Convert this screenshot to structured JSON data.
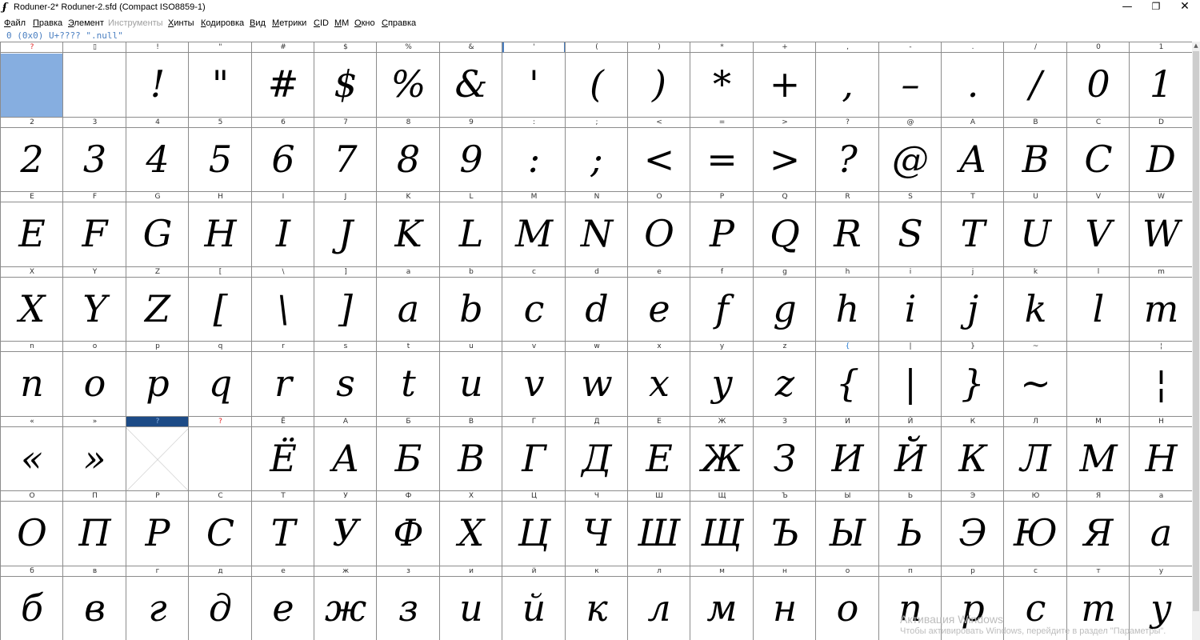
{
  "window": {
    "title": "Roduner-2*  Roduner-2.sfd (Compact ISO8859-1)",
    "app_icon_glyph": "ʄ",
    "minimize_glyph": "—",
    "maximize_glyph": "❐",
    "close_glyph": "✕"
  },
  "menu": [
    {
      "label": "Файл",
      "disabled": false
    },
    {
      "label": "Правка",
      "disabled": false
    },
    {
      "label": "Элемент",
      "disabled": false
    },
    {
      "label": "Инструменты",
      "disabled": true
    },
    {
      "label": "Хинты",
      "disabled": false
    },
    {
      "label": "Кодировка",
      "disabled": false
    },
    {
      "label": "Вид",
      "disabled": false
    },
    {
      "label": "Метрики",
      "disabled": false
    },
    {
      "label": "CID",
      "disabled": false
    },
    {
      "label": "MM",
      "disabled": false
    },
    {
      "label": "Окно",
      "disabled": false
    },
    {
      "label": "Справка",
      "disabled": false
    }
  ],
  "info_line": "0 (0x0) U+???? \".null\"",
  "colors": {
    "selected_glyph_bg": "#86aee0",
    "selected_label_bg": "#1d4b86",
    "missing_label": "#e02020",
    "info_text": "#4a7fc1"
  },
  "rows": [
    [
      {
        "label": "?",
        "glyph": "",
        "label_color": "red",
        "selected": true
      },
      {
        "label": "▯",
        "glyph": ""
      },
      {
        "label": "!",
        "glyph": "!"
      },
      {
        "label": "\"",
        "glyph": "\""
      },
      {
        "label": "#",
        "glyph": "#"
      },
      {
        "label": "$",
        "glyph": "$"
      },
      {
        "label": "%",
        "glyph": "%"
      },
      {
        "label": "&",
        "glyph": "&"
      },
      {
        "label": "'",
        "glyph": "'",
        "tick": true
      },
      {
        "label": "(",
        "glyph": "("
      },
      {
        "label": ")",
        "glyph": ")"
      },
      {
        "label": "*",
        "glyph": "*"
      },
      {
        "label": "+",
        "glyph": "+"
      },
      {
        "label": ",",
        "glyph": ","
      },
      {
        "label": "-",
        "glyph": "–"
      },
      {
        "label": ".",
        "glyph": "."
      },
      {
        "label": "/",
        "glyph": "/"
      },
      {
        "label": "0",
        "glyph": "0"
      },
      {
        "label": "1",
        "glyph": "1"
      }
    ],
    [
      {
        "label": "2",
        "glyph": "2"
      },
      {
        "label": "3",
        "glyph": "3"
      },
      {
        "label": "4",
        "glyph": "4"
      },
      {
        "label": "5",
        "glyph": "5"
      },
      {
        "label": "6",
        "glyph": "6"
      },
      {
        "label": "7",
        "glyph": "7"
      },
      {
        "label": "8",
        "glyph": "8"
      },
      {
        "label": "9",
        "glyph": "9"
      },
      {
        "label": ":",
        "glyph": ":"
      },
      {
        "label": ";",
        "glyph": ";"
      },
      {
        "label": "<",
        "glyph": "<"
      },
      {
        "label": "=",
        "glyph": "="
      },
      {
        "label": ">",
        "glyph": ">"
      },
      {
        "label": "?",
        "glyph": "?"
      },
      {
        "label": "@",
        "glyph": "@"
      },
      {
        "label": "A",
        "glyph": "A"
      },
      {
        "label": "B",
        "glyph": "B"
      },
      {
        "label": "C",
        "glyph": "C"
      },
      {
        "label": "D",
        "glyph": "D"
      }
    ],
    [
      {
        "label": "E",
        "glyph": "E"
      },
      {
        "label": "F",
        "glyph": "F"
      },
      {
        "label": "G",
        "glyph": "G"
      },
      {
        "label": "H",
        "glyph": "H"
      },
      {
        "label": "I",
        "glyph": "I"
      },
      {
        "label": "J",
        "glyph": "J"
      },
      {
        "label": "K",
        "glyph": "K"
      },
      {
        "label": "L",
        "glyph": "L"
      },
      {
        "label": "M",
        "glyph": "M"
      },
      {
        "label": "N",
        "glyph": "N"
      },
      {
        "label": "O",
        "glyph": "O"
      },
      {
        "label": "P",
        "glyph": "P"
      },
      {
        "label": "Q",
        "glyph": "Q"
      },
      {
        "label": "R",
        "glyph": "R"
      },
      {
        "label": "S",
        "glyph": "S"
      },
      {
        "label": "T",
        "glyph": "T"
      },
      {
        "label": "U",
        "glyph": "U"
      },
      {
        "label": "V",
        "glyph": "V"
      },
      {
        "label": "W",
        "glyph": "W"
      }
    ],
    [
      {
        "label": "X",
        "glyph": "X"
      },
      {
        "label": "Y",
        "glyph": "Y"
      },
      {
        "label": "Z",
        "glyph": "Z"
      },
      {
        "label": "[",
        "glyph": "["
      },
      {
        "label": "\\",
        "glyph": "\\"
      },
      {
        "label": "]",
        "glyph": "]"
      },
      {
        "label": "a",
        "glyph": "a"
      },
      {
        "label": "b",
        "glyph": "b"
      },
      {
        "label": "c",
        "glyph": "c"
      },
      {
        "label": "d",
        "glyph": "d"
      },
      {
        "label": "e",
        "glyph": "e"
      },
      {
        "label": "f",
        "glyph": "f"
      },
      {
        "label": "g",
        "glyph": "g"
      },
      {
        "label": "h",
        "glyph": "h"
      },
      {
        "label": "i",
        "glyph": "i"
      },
      {
        "label": "j",
        "glyph": "j"
      },
      {
        "label": "k",
        "glyph": "k"
      },
      {
        "label": "l",
        "glyph": "l"
      },
      {
        "label": "m",
        "glyph": "m"
      }
    ],
    [
      {
        "label": "n",
        "glyph": "n"
      },
      {
        "label": "o",
        "glyph": "o"
      },
      {
        "label": "p",
        "glyph": "p"
      },
      {
        "label": "q",
        "glyph": "q"
      },
      {
        "label": "r",
        "glyph": "r"
      },
      {
        "label": "s",
        "glyph": "s"
      },
      {
        "label": "t",
        "glyph": "t"
      },
      {
        "label": "u",
        "glyph": "u"
      },
      {
        "label": "v",
        "glyph": "v"
      },
      {
        "label": "w",
        "glyph": "w"
      },
      {
        "label": "x",
        "glyph": "x"
      },
      {
        "label": "y",
        "glyph": "y"
      },
      {
        "label": "z",
        "glyph": "z"
      },
      {
        "label": "{",
        "glyph": "{",
        "label_color": "blue"
      },
      {
        "label": "|",
        "glyph": "|"
      },
      {
        "label": "}",
        "glyph": "}"
      },
      {
        "label": "~",
        "glyph": "~"
      },
      {
        "label": "",
        "glyph": ""
      },
      {
        "label": "¦",
        "glyph": "¦"
      }
    ],
    [
      {
        "label": "«",
        "glyph": "«"
      },
      {
        "label": "»",
        "glyph": "»"
      },
      {
        "label": "?",
        "glyph": "",
        "selected_label": true,
        "cross": true
      },
      {
        "label": "?",
        "glyph": "",
        "label_color": "red"
      },
      {
        "label": "Ё",
        "glyph": "Ё"
      },
      {
        "label": "А",
        "glyph": "А"
      },
      {
        "label": "Б",
        "glyph": "Б"
      },
      {
        "label": "В",
        "glyph": "В"
      },
      {
        "label": "Г",
        "glyph": "Г"
      },
      {
        "label": "Д",
        "glyph": "Д"
      },
      {
        "label": "Е",
        "glyph": "Е"
      },
      {
        "label": "Ж",
        "glyph": "Ж"
      },
      {
        "label": "З",
        "glyph": "З"
      },
      {
        "label": "И",
        "glyph": "И"
      },
      {
        "label": "Й",
        "glyph": "Й"
      },
      {
        "label": "К",
        "glyph": "К"
      },
      {
        "label": "Л",
        "glyph": "Л"
      },
      {
        "label": "М",
        "glyph": "М"
      },
      {
        "label": "Н",
        "glyph": "Н"
      }
    ],
    [
      {
        "label": "О",
        "glyph": "О"
      },
      {
        "label": "П",
        "glyph": "П"
      },
      {
        "label": "Р",
        "glyph": "Р"
      },
      {
        "label": "С",
        "glyph": "С"
      },
      {
        "label": "Т",
        "glyph": "Т"
      },
      {
        "label": "У",
        "glyph": "У"
      },
      {
        "label": "Ф",
        "glyph": "Ф"
      },
      {
        "label": "Х",
        "glyph": "Х"
      },
      {
        "label": "Ц",
        "glyph": "Ц"
      },
      {
        "label": "Ч",
        "glyph": "Ч"
      },
      {
        "label": "Ш",
        "glyph": "Ш"
      },
      {
        "label": "Щ",
        "glyph": "Щ"
      },
      {
        "label": "Ъ",
        "glyph": "Ъ"
      },
      {
        "label": "Ы",
        "glyph": "Ы"
      },
      {
        "label": "Ь",
        "glyph": "Ь"
      },
      {
        "label": "Э",
        "glyph": "Э"
      },
      {
        "label": "Ю",
        "glyph": "Ю"
      },
      {
        "label": "Я",
        "glyph": "Я"
      },
      {
        "label": "а",
        "glyph": "а"
      }
    ],
    [
      {
        "label": "б",
        "glyph": "б"
      },
      {
        "label": "в",
        "glyph": "в"
      },
      {
        "label": "г",
        "glyph": "г"
      },
      {
        "label": "д",
        "glyph": "д"
      },
      {
        "label": "е",
        "glyph": "е"
      },
      {
        "label": "ж",
        "glyph": "ж"
      },
      {
        "label": "з",
        "glyph": "з"
      },
      {
        "label": "и",
        "glyph": "и"
      },
      {
        "label": "й",
        "glyph": "й"
      },
      {
        "label": "к",
        "glyph": "к"
      },
      {
        "label": "л",
        "glyph": "л"
      },
      {
        "label": "м",
        "glyph": "м"
      },
      {
        "label": "н",
        "glyph": "н"
      },
      {
        "label": "о",
        "glyph": "о"
      },
      {
        "label": "п",
        "glyph": "п"
      },
      {
        "label": "р",
        "glyph": "р"
      },
      {
        "label": "с",
        "glyph": "с"
      },
      {
        "label": "т",
        "glyph": "т"
      },
      {
        "label": "у",
        "glyph": "у"
      }
    ]
  ],
  "watermark": {
    "line1": "Активация Windows",
    "line2": "Чтобы активировать Windows, перейдите в раздел \"Параметры\"."
  }
}
